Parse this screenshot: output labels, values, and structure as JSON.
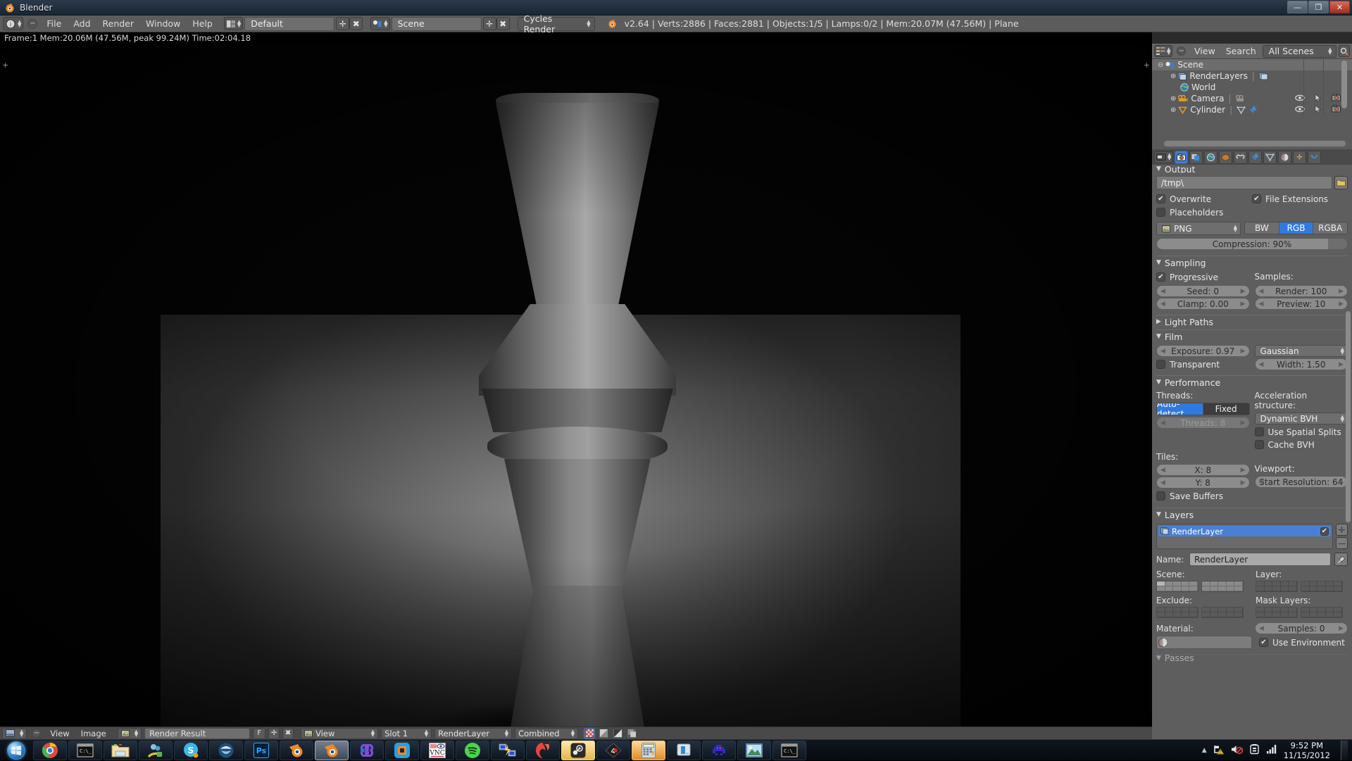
{
  "window": {
    "title": "Blender",
    "app_icon": "blender-logo-icon",
    "minimize_label": "—",
    "maximize_label": "❐",
    "close_label": "✕"
  },
  "topbar": {
    "editor_type_icon": "info-editor-icon",
    "collapse_icon": "minus-circle-icon",
    "menus": [
      "File",
      "Add",
      "Render",
      "Window",
      "Help"
    ],
    "screen_layout": {
      "icon": "screen-layout-icon",
      "value": "Default",
      "add_label": "✛",
      "delete_label": "✖"
    },
    "scene": {
      "icon": "scene-icon",
      "value": "Scene",
      "add_label": "✛",
      "delete_label": "✖"
    },
    "render_engine": {
      "value": "Cycles Render"
    },
    "status": "v2.64 | Verts:2886 | Faces:2881 | Objects:1/5 | Lamps:0/2 | Mem:20.07M (47.56M) | Plane",
    "status_icon": "blender-logo-icon"
  },
  "info_line": {
    "text": "Frame:1 Mem:20.06M (47.56M, peak 99.24M) Time:02:04.18"
  },
  "image_editor": {
    "render_description": "Cycles render of a grey chess-pawn-like lathe object standing on a grey plane against a black background",
    "footer": {
      "editor_type_icon": "image-editor-icon",
      "collapse_icon": "minus-circle-icon",
      "menus": [
        "View",
        "Image"
      ],
      "image_datablock": {
        "icon": "image-icon",
        "value": "Render Result",
        "fake_user_label": "F",
        "add_label": "✛",
        "delete_label": "✖"
      },
      "view_mode": {
        "icon": "image-icon",
        "value": "View"
      },
      "slot": "Slot 1",
      "render_layer": "RenderLayer",
      "pass": "Combined",
      "display_buttons": [
        "color-and-alpha-icon",
        "color-icon",
        "alpha-icon",
        "zdepth-icon"
      ]
    }
  },
  "outliner": {
    "header": {
      "editor_type_icon": "outliner-editor-icon",
      "collapse_icon": "minus-circle-icon",
      "menus": [
        "View",
        "Search"
      ],
      "display_mode": "All Scenes",
      "search_icon": "magnifier-icon"
    },
    "rows": [
      {
        "label": "Scene",
        "icon": "scene-icon",
        "indent": 0,
        "expander": "minus",
        "selected": true,
        "extra_icons": [],
        "eye": false
      },
      {
        "label": "RenderLayers",
        "icon": "renderlayers-icon",
        "indent": 1,
        "expander": "plus",
        "selected": false,
        "extra_icons": [
          "renderlayers-data-icon"
        ],
        "eye": false
      },
      {
        "label": "World",
        "icon": "world-icon",
        "indent": 1,
        "expander": "none",
        "selected": false,
        "extra_icons": [],
        "eye": false
      },
      {
        "label": "Camera",
        "icon": "camera-icon",
        "indent": 1,
        "expander": "plus",
        "selected": false,
        "extra_icons": [
          "camera-data-icon"
        ],
        "eye": true
      },
      {
        "label": "Cylinder",
        "icon": "mesh-tri-icon",
        "indent": 1,
        "expander": "plus",
        "selected": false,
        "extra_icons": [
          "mesh-data-icon",
          "wrench-icon"
        ],
        "eye": true
      }
    ],
    "row_toggle_icons": [
      "eye-icon",
      "cursor-arrow-icon",
      "camera-render-icon"
    ]
  },
  "properties": {
    "tabs": [
      {
        "name": "render-tab",
        "icon": "camera-back-icon",
        "active": true
      },
      {
        "name": "render-layers-tab",
        "icon": "render-layers-icon",
        "active": false
      },
      {
        "name": "scene-tab",
        "icon": "scene-cone-icon",
        "active": false
      },
      {
        "name": "world-tab",
        "icon": "world-globe-icon",
        "active": false
      },
      {
        "name": "object-tab",
        "icon": "object-cube-icon",
        "active": false
      },
      {
        "name": "constraints-tab",
        "icon": "chain-icon",
        "active": false
      },
      {
        "name": "modifiers-tab",
        "icon": "wrench-icon",
        "active": false
      },
      {
        "name": "data-tab",
        "icon": "mesh-data-icon",
        "active": false
      },
      {
        "name": "material-tab",
        "icon": "material-sphere-icon",
        "active": false
      },
      {
        "name": "particles-tab",
        "icon": "particles-icon",
        "active": false
      },
      {
        "name": "physics-tab",
        "icon": "physics-icon",
        "active": false
      }
    ],
    "output": {
      "title": "Output",
      "path": "/tmp\\",
      "browse_icon": "folder-icon",
      "overwrite": {
        "label": "Overwrite",
        "checked": true
      },
      "file_extensions": {
        "label": "File Extensions",
        "checked": true
      },
      "placeholders": {
        "label": "Placeholders",
        "checked": false
      },
      "file_format": {
        "icon": "image-file-icon",
        "value": "PNG"
      },
      "color_modes": [
        "BW",
        "RGB",
        "RGBA"
      ],
      "color_mode_selected": "RGB",
      "compression": "Compression: 90%",
      "compression_percent": 90
    },
    "sampling": {
      "title": "Sampling",
      "progressive": {
        "label": "Progressive",
        "checked": true
      },
      "samples_label": "Samples:",
      "seed": "Seed: 0",
      "clamp": "Clamp: 0.00",
      "render_samples": "Render: 100",
      "preview_samples": "Preview: 10"
    },
    "light_paths": {
      "title": "Light Paths",
      "expanded": false
    },
    "film": {
      "title": "Film",
      "exposure": "Exposure: 0.97",
      "filter_type": "Gaussian",
      "width": "Width: 1.50",
      "transparent": {
        "label": "Transparent",
        "checked": false
      }
    },
    "performance": {
      "title": "Performance",
      "threads_label": "Threads:",
      "thread_modes": [
        "Auto-detect",
        "Fixed"
      ],
      "thread_mode_selected": "Auto-detect",
      "threads_count": "Threads: 8",
      "acceleration_label": "Acceleration structure:",
      "acceleration_value": "Dynamic BVH",
      "use_spatial_splits": {
        "label": "Use Spatial Splits",
        "checked": false
      },
      "cache_bvh": {
        "label": "Cache BVH",
        "checked": false
      },
      "tiles_label": "Tiles:",
      "tiles_x": "X: 8",
      "tiles_y": "Y: 8",
      "viewport_label": "Viewport:",
      "start_resolution": "Start Resolution: 64",
      "save_buffers": {
        "label": "Save Buffers",
        "checked": false
      }
    },
    "layers": {
      "title": "Layers",
      "list_item": {
        "label": "RenderLayer",
        "icon": "renderlayers-icon",
        "enabled": true
      },
      "add_label": "✛",
      "remove_label": "—",
      "name_label": "Name:",
      "name_value": "RenderLayer",
      "pin_icon": "pin-icon",
      "scene_label": "Scene:",
      "layer_label": "Layer:",
      "exclude_label": "Exclude:",
      "mask_layers_label": "Mask Layers:",
      "material_label": "Material:",
      "material_value": "",
      "material_icon": "material-sphere-icon",
      "samples": "Samples: 0",
      "use_environment": {
        "label": "Use Environment",
        "checked": true
      },
      "passes_title": "Passes"
    }
  },
  "taskbar": {
    "start_label": "start-orb",
    "items": [
      {
        "name": "chrome",
        "icon": "chrome-icon",
        "active": false
      },
      {
        "name": "command-prompt",
        "icon": "console-icon",
        "active": false
      },
      {
        "name": "windows-explorer",
        "icon": "folder-explorer-icon",
        "active": false
      },
      {
        "name": "messenger",
        "icon": "messenger-icon",
        "active": false
      },
      {
        "name": "skype",
        "icon": "skype-icon",
        "active": false
      },
      {
        "name": "thunderbird",
        "icon": "thunderbird-icon",
        "active": false
      },
      {
        "name": "photoshop",
        "icon": "photoshop-icon",
        "active": false
      },
      {
        "name": "blender-1",
        "icon": "blender-icon",
        "active": false
      },
      {
        "name": "blender-2",
        "icon": "blender-icon",
        "active": true
      },
      {
        "name": "infinity-app",
        "icon": "infinity-icon",
        "active": false
      },
      {
        "name": "virtualbox",
        "icon": "virtualbox-icon",
        "active": false
      },
      {
        "name": "vnc-viewer",
        "icon": "vnc-icon",
        "active": false
      },
      {
        "name": "spotify",
        "icon": "spotify-icon",
        "active": false
      },
      {
        "name": "remote-desktop",
        "icon": "remote-desktop-icon",
        "active": false
      },
      {
        "name": "firefox",
        "icon": "firefox-icon",
        "active": false
      },
      {
        "name": "steam",
        "icon": "steam-icon",
        "active": false
      },
      {
        "name": "4d-app",
        "icon": "diamond-4d-icon",
        "active": false
      },
      {
        "name": "calculator",
        "icon": "calculator-icon",
        "active": false
      },
      {
        "name": "monitor-app",
        "icon": "monitor-icon",
        "active": false
      },
      {
        "name": "space-invader-app",
        "icon": "invader-icon",
        "active": false
      },
      {
        "name": "photo-viewer",
        "icon": "picture-icon",
        "active": false
      },
      {
        "name": "console-2",
        "icon": "console-icon",
        "active": false
      }
    ],
    "tray": {
      "show_hidden_label": "▲",
      "icons": [
        "network-warning-icon",
        "volume-muted-icon",
        "action-center-icon",
        "signal-bars-icon"
      ],
      "time": "9:52 PM",
      "date": "11/15/2012"
    }
  }
}
